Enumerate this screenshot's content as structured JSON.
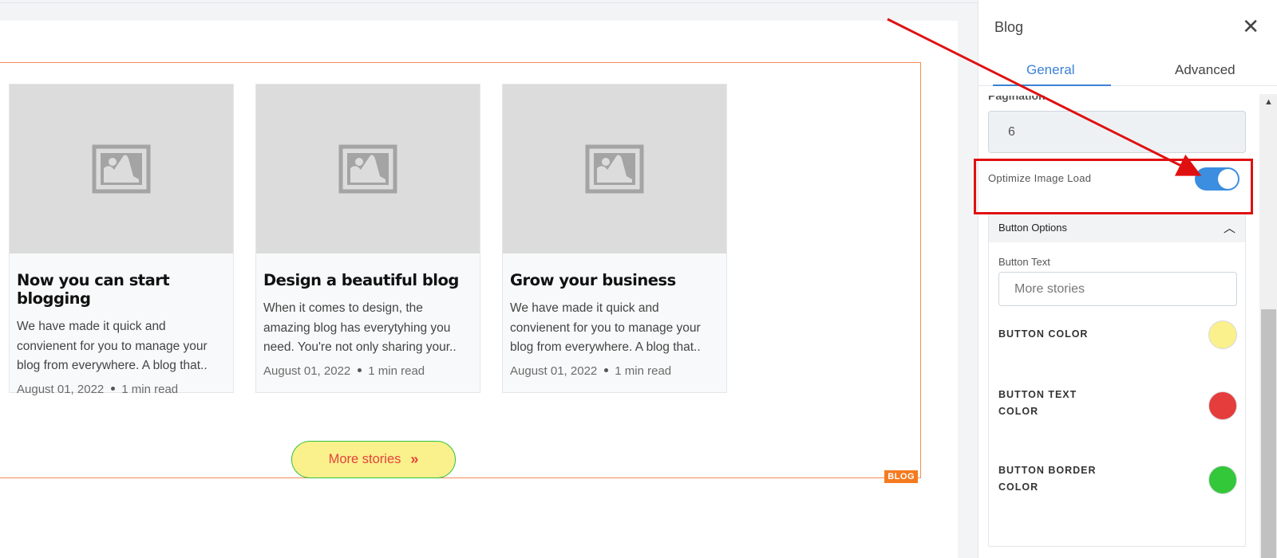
{
  "canvas": {
    "section_tag": "BLOG",
    "cards": [
      {
        "title": "Now you can start blogging",
        "excerpt": "We have made it quick and convienent for you to manage your blog from everywhere. A blog that..",
        "date": "August 01, 2022",
        "read_time": "1 min read"
      },
      {
        "title": "Design a beautiful blog",
        "excerpt": "When it comes to design, the amazing blog has everytyhing you need. You're not only sharing your..",
        "date": "August 01, 2022",
        "read_time": "1 min read"
      },
      {
        "title": "Grow your business",
        "excerpt": "We have made it quick and convienent for you to manage your blog from everywhere. A blog that..",
        "date": "August 01, 2022",
        "read_time": "1 min read"
      }
    ],
    "more_button": {
      "label": "More stories",
      "icon": "double-chevron-right"
    }
  },
  "panel": {
    "title": "Blog",
    "close_icon": "close-x",
    "tabs": [
      {
        "label": "General",
        "active": true
      },
      {
        "label": "Advanced",
        "active": false
      }
    ],
    "pagination_label_partial": "Pagination",
    "pagination_value": "6",
    "optimize_image_load": {
      "label": "Optimize Image Load",
      "enabled": true
    },
    "button_options": {
      "header": "Button Options",
      "button_text_label": "Button Text",
      "button_text_value": "More stories",
      "colors": [
        {
          "label": "BUTTON COLOR",
          "value": "#faf08c"
        },
        {
          "label": "BUTTON TEXT COLOR",
          "value": "#e53c3c"
        },
        {
          "label": "BUTTON BORDER COLOR",
          "value": "#33c73a"
        }
      ]
    }
  },
  "colors": {
    "accent": "#3b82d6",
    "section_border": "#f28c5a",
    "annotation": "#e01010"
  }
}
